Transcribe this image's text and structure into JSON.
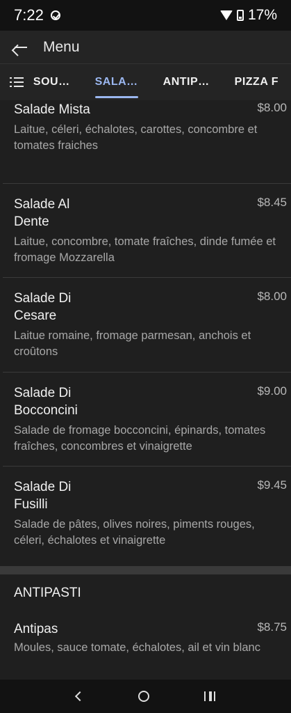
{
  "status": {
    "time": "7:22",
    "battery": "17%"
  },
  "appbar": {
    "title": "Menu"
  },
  "tabs": [
    {
      "label": "SOU…",
      "active": false
    },
    {
      "label": "SALA…",
      "active": true
    },
    {
      "label": "ANTIP…",
      "active": false
    },
    {
      "label": "PIZZA F",
      "active": false
    }
  ],
  "salads": [
    {
      "name": "Salade Mista",
      "price": "$8.00",
      "desc": "Laitue, céleri, échalotes, carottes, concombre et tomates fraiches"
    },
    {
      "name": "Salade Al Dente",
      "price": "$8.45",
      "desc": "Laitue, concombre, tomate fraîches, dinde fumée et fromage Mozzarella"
    },
    {
      "name": "Salade Di Cesare",
      "price": "$8.00",
      "desc": "Laitue romaine, fromage parmesan, anchois et croûtons"
    },
    {
      "name": "Salade Di Bocconcini",
      "price": "$9.00",
      "desc": "Salade de fromage bocconcini, épinards, tomates fraîches, concombres et vinaigrette"
    },
    {
      "name": "Salade Di Fusilli",
      "price": "$9.45",
      "desc": "Salade de pâtes, olives noires, piments rouges, céleri, échalotes et vinaigrette"
    }
  ],
  "antipasti": {
    "title": "ANTIPASTI",
    "items": [
      {
        "name": "Antipas",
        "price": "$8.75",
        "desc": "Moules, sauce tomate, échalotes, ail et vin blanc"
      }
    ]
  },
  "colors": {
    "accent": "#9bb7f0",
    "background": "#1f1f1f",
    "bar": "#242424"
  },
  "icons": {
    "back": "arrow-left-icon",
    "list": "list-icon",
    "nav_back": "chevron-left-icon",
    "nav_home": "circle-home-icon",
    "nav_recent": "recents-icon"
  }
}
